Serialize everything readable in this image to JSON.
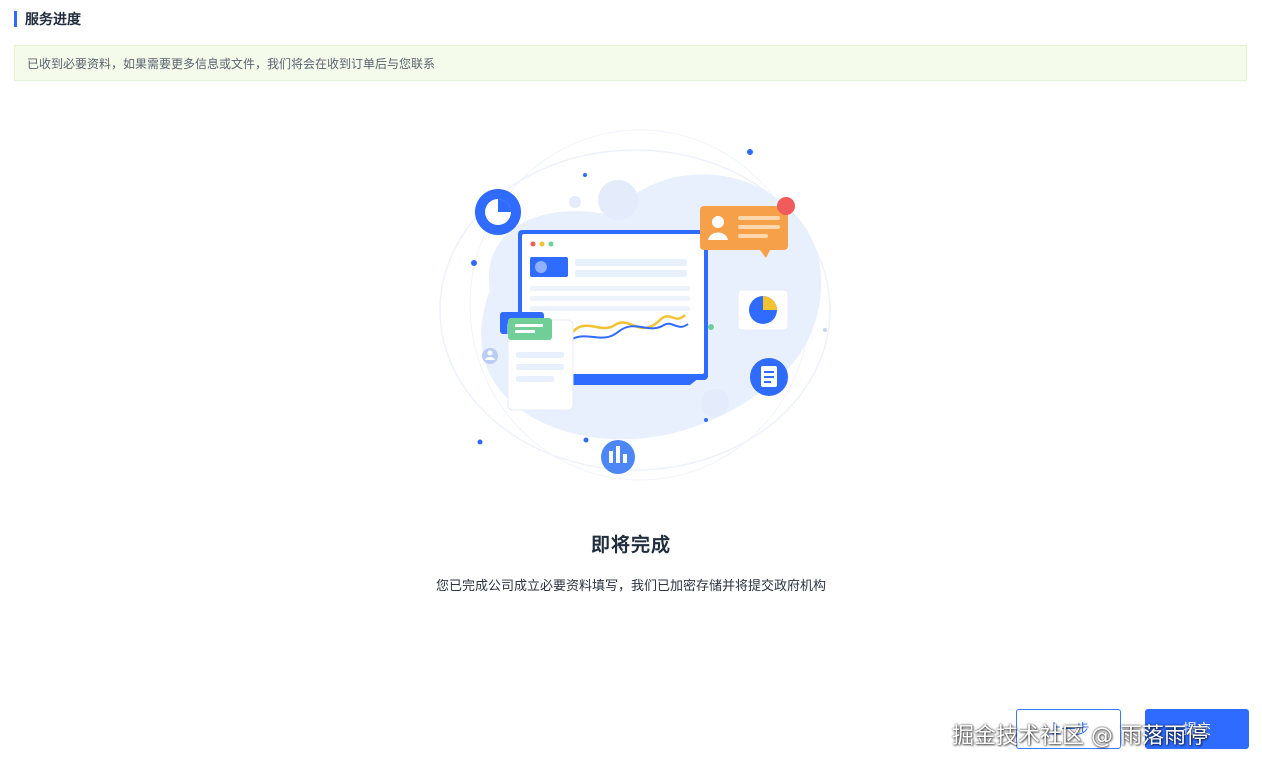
{
  "header": {
    "section_title": "服务进度"
  },
  "notice": {
    "text": "已收到必要资料，如果需要更多信息或文件，我们将会在收到订单后与您联系"
  },
  "status": {
    "title": "即将完成",
    "description": "您已完成公司成立必要资料填写，我们已加密存储并将提交政府机构"
  },
  "actions": {
    "secondary_label": "上一步",
    "primary_label": "提交"
  },
  "watermark": {
    "text": "掘金技术社区 @ 雨落雨停"
  },
  "colors": {
    "accent": "#2f6bff",
    "notice_bg": "#f4fbea",
    "illustration_blob": "#e8effd",
    "card_orange": "#f6a14a",
    "badge_red": "#f25b5b",
    "card_green": "#6fcf97",
    "line_yellow": "#f2c230"
  },
  "icons": [
    "pie-chart-icon",
    "user-icon",
    "document-icon",
    "bar-chart-icon"
  ]
}
